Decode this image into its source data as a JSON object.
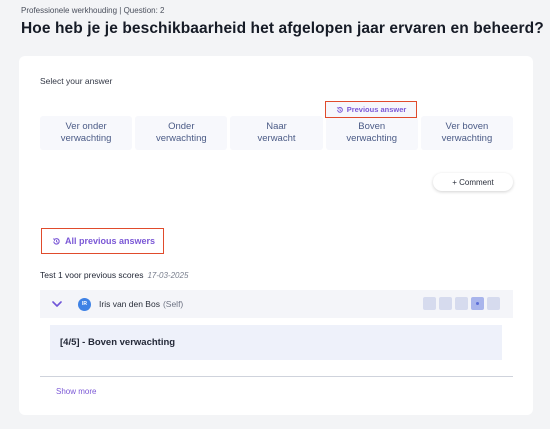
{
  "breadcrumb": "Professionele werkhouding | Question: 2",
  "question": "Hoe heb je je beschikbaarheid het afgelopen jaar ervaren en beheerd?",
  "select_label": "Select your answer",
  "options": [
    {
      "label": "Ver onder\nverwachting"
    },
    {
      "label": "Onder\nverwachting"
    },
    {
      "label": "Naar\nverwacht"
    },
    {
      "label": "Boven\nverwachting"
    },
    {
      "label": "Ver boven\nverwachting"
    }
  ],
  "previous_answer_tag": "Previous answer",
  "comment_button": "+ Comment",
  "all_previous_answers": "All previous answers",
  "test": {
    "title": "Test 1 voor previous scores",
    "date": "17-03-2025"
  },
  "person": {
    "initials": "IR",
    "name": "Iris van den Bos",
    "role": "(Self)"
  },
  "score": {
    "selected": 4,
    "max": 5
  },
  "answer_text": "[4/5] - Boven verwachting",
  "show_more": "Show more",
  "colors": {
    "accent": "#7b58d6",
    "highlight_border": "#e04b2c",
    "avatar": "#3f82e5"
  }
}
